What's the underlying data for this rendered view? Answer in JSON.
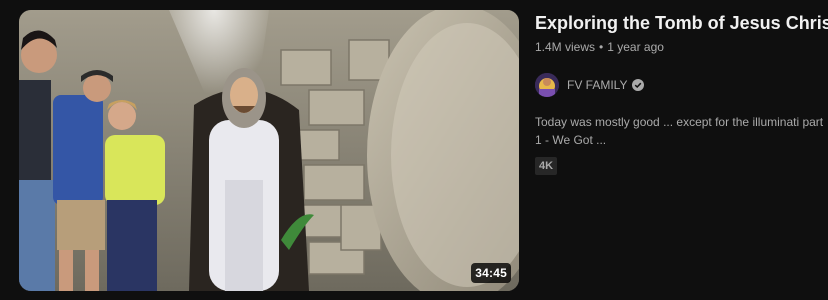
{
  "video": {
    "title": "Exploring the Tomb of Jesus Christ",
    "views": "1.4M views",
    "separator": "•",
    "age": "1 year ago",
    "duration": "34:45",
    "channel": "FV FAMILY",
    "description": "Today was mostly good ... except for the illuminati part 1 - We Got ...",
    "badge": "4K"
  },
  "icons": {
    "verified": "verified-check-icon",
    "avatar": "channel-avatar"
  },
  "colors": {
    "background": "#0f0f0f",
    "primary_text": "#f1f1f1",
    "secondary_text": "#aaaaaa",
    "badge_bg": "#272727"
  }
}
